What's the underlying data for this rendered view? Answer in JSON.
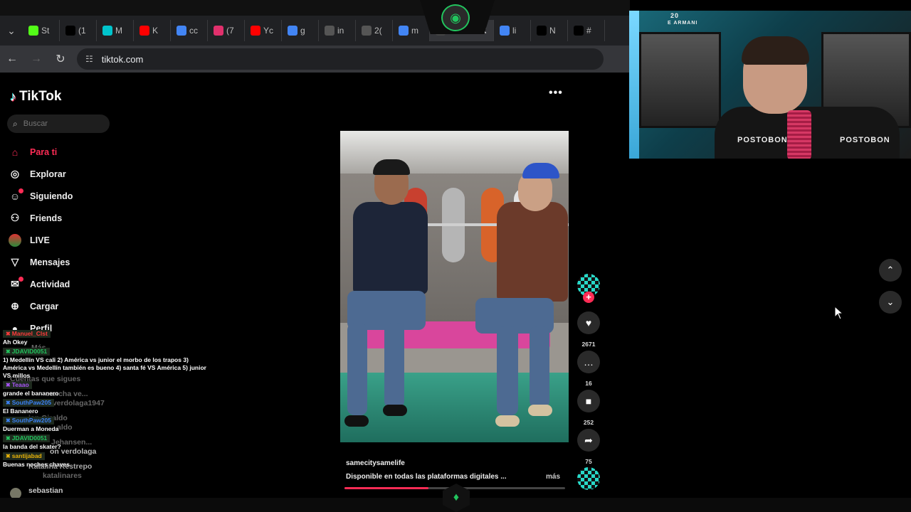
{
  "browser": {
    "tabs": [
      {
        "icon": "kick-icon",
        "label": "St",
        "color": "#53fc18"
      },
      {
        "icon": "x-icon",
        "label": "(1",
        "color": "#000000"
      },
      {
        "icon": "canva-icon",
        "label": "M",
        "color": "#00c4cc"
      },
      {
        "icon": "youtube-icon",
        "label": "K",
        "color": "#ff0000"
      },
      {
        "icon": "google-icon",
        "label": "cc",
        "color": "#4285f4"
      },
      {
        "icon": "instagram-icon",
        "label": "(7",
        "color": "#e1306c"
      },
      {
        "icon": "youtube-icon",
        "label": "Yc",
        "color": "#ff0000"
      },
      {
        "icon": "google-icon",
        "label": "g",
        "color": "#4285f4"
      },
      {
        "icon": "globe-icon",
        "label": "in",
        "color": "#555555"
      },
      {
        "icon": "globe-icon",
        "label": "2(",
        "color": "#555555"
      },
      {
        "icon": "google-icon",
        "label": "m",
        "color": "#4285f4"
      }
    ],
    "tabs_right": [
      {
        "icon": "google-icon",
        "label": "li",
        "color": "#4285f4"
      },
      {
        "icon": "x-icon",
        "label": "N",
        "color": "#000000"
      },
      {
        "icon": "tiktok-icon",
        "label": "#",
        "color": "#000000"
      }
    ],
    "url": "tiktok.com"
  },
  "sidebar": {
    "logo": "TikTok",
    "search_placeholder": "Buscar",
    "items": [
      {
        "label": "Para ti",
        "icon": "home-icon",
        "active": true
      },
      {
        "label": "Explorar",
        "icon": "compass-icon"
      },
      {
        "label": "Siguiendo",
        "icon": "following-icon"
      },
      {
        "label": "Friends",
        "icon": "friends-icon"
      },
      {
        "label": "LIVE",
        "icon": "live-icon"
      },
      {
        "label": "Mensajes",
        "icon": "send-icon"
      },
      {
        "label": "Actividad",
        "icon": "inbox-icon"
      },
      {
        "label": "Cargar",
        "icon": "upload-icon"
      },
      {
        "label": "Perfil",
        "icon": "profile-icon"
      }
    ],
    "faded": {
      "mas": "Más",
      "cuentas": "Cuentas que sigues",
      "a1": "cancha ve...",
      "a2": "hinchaverdolaga1947",
      "a3": "ian Giraldo",
      "a4": "aldo",
      "a5": "Jehansen...",
      "a6": "on verdolaga",
      "a7": "Katalina Restrepo",
      "a8": "katalinares",
      "a9": "sebastian"
    }
  },
  "chat": [
    {
      "user": "Manuel_Clst",
      "msg": "Ah Okey",
      "badge": "#ff3b3b"
    },
    {
      "user": "JDAVID0051",
      "msg": "1) Medellín VS cali 2) América vs junior el morbo de los trapos 3) América vs Medellín también es bueno 4) santa fé VS América 5) junior VS millos",
      "badge": "#22c55e"
    },
    {
      "user": "Teaao",
      "msg": "grande el bananero",
      "badge": "#a855f7"
    },
    {
      "user": "SouthPaw205",
      "msg": "El Bananero",
      "badge": "#3b82f6"
    },
    {
      "user": "SouthPaw205",
      "msg": "Duerman a Moneda",
      "badge": "#3b82f6"
    },
    {
      "user": "JDAVID0051",
      "msg": "la banda del skater?",
      "badge": "#22c55e"
    },
    {
      "user": "santijabad",
      "msg": "Buenas noches chaves",
      "badge": "#eab308"
    }
  ],
  "video": {
    "author": "samecitysamelife",
    "description": "Disponible en todas las plataformas digitales ...",
    "more_label": "más",
    "progress": 0.38
  },
  "actions": {
    "likes": "2671",
    "comments": "16",
    "saves": "252",
    "shares": "75"
  },
  "webcam": {
    "shirt_brand": "POSTOBON",
    "poster_text": "E ARMANI",
    "poster_number": "20"
  },
  "colors": {
    "accent": "#fe2c55",
    "overlay_green": "#22c55e"
  }
}
